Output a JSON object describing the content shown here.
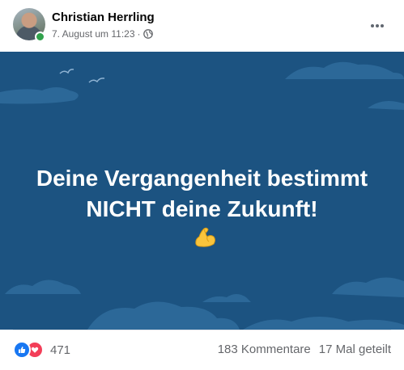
{
  "post": {
    "author": "Christian Herrling",
    "timestamp": "7. August um 11:23",
    "separator": "·",
    "audience_icon": "globe-icon",
    "more_icon": "more-horizontal-icon",
    "image_text_line1": "Deine Vergangenheit bestimmt",
    "image_text_line2": "NICHT deine Zukunft!",
    "emoji": "flexed-biceps-icon"
  },
  "footer": {
    "reaction_icons": [
      "like-icon",
      "love-icon"
    ],
    "reaction_count": "471",
    "comments": "183 Kommentare",
    "shares": "17 Mal geteilt"
  },
  "colors": {
    "image_background": "#1c5381",
    "cloud": "#2c6898",
    "like": "#1877f2",
    "love": "#f33e58",
    "online": "#31a24c"
  }
}
